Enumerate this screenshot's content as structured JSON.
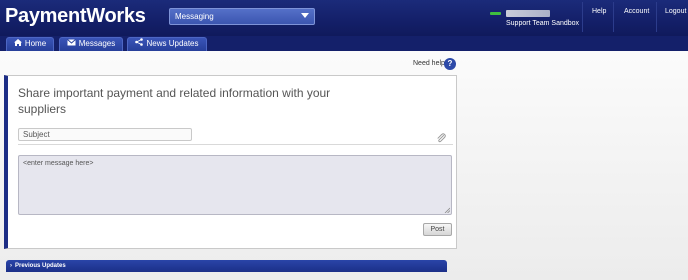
{
  "header": {
    "logo": "PaymentWorks",
    "module_select": "Messaging",
    "user_org": "Support Team Sandbox",
    "links": [
      "Help",
      "Account",
      "Logout"
    ]
  },
  "nav": {
    "tabs": [
      {
        "label": "Home",
        "icon": "home-icon"
      },
      {
        "label": "Messages",
        "icon": "envelope-icon"
      },
      {
        "label": "News Updates",
        "icon": "share-icon"
      }
    ]
  },
  "help": {
    "label": "Need help",
    "icon_glyph": "?"
  },
  "compose": {
    "title": "Share important payment and related information with your suppliers",
    "subject_placeholder": "Subject",
    "message_placeholder": "<enter message here>",
    "post_label": "Post"
  },
  "previous_updates": {
    "label": "Previous Updates"
  },
  "colors": {
    "header_bg": "#14206a",
    "tab_bg": "#273f9a",
    "accent": "#1c2d85",
    "status_online": "#3fbf3f"
  }
}
